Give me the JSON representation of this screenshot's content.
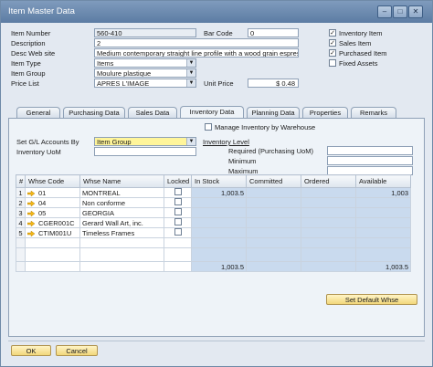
{
  "window": {
    "title": "Item Master Data"
  },
  "header": {
    "item_number_label": "Item Number",
    "item_number_series": "560-410",
    "bar_code_label": "Bar Code",
    "bar_code": "0",
    "description_label": "Description",
    "description": "2",
    "desc_web_label": "Desc Web site",
    "desc_web": "Medium contemporary straight line profile with a wood grain espresso",
    "item_type_label": "Item Type",
    "item_type": "Items",
    "item_group_label": "Item Group",
    "item_group": "Moulure plastique",
    "price_list_label": "Price List",
    "price_list": "APRES L'IMAGE",
    "unit_price_label": "Unit Price",
    "unit_price": "$ 0.48"
  },
  "flags": [
    {
      "label": "Inventory Item",
      "checked": "✓"
    },
    {
      "label": "Sales Item",
      "checked": "✓"
    },
    {
      "label": "Purchased Item",
      "checked": "✓"
    },
    {
      "label": "Fixed Assets",
      "checked": ""
    }
  ],
  "tabs": [
    "General",
    "Purchasing Data",
    "Sales Data",
    "Inventory Data",
    "Planning Data",
    "Properties",
    "Remarks"
  ],
  "inventory": {
    "manage_by_wh_label": "Manage Inventory by Warehouse",
    "gl_label": "Set G/L Accounts By",
    "gl_value": "Item Group",
    "uom_label": "Inventory UoM",
    "inv_level_label": "Inventory Level",
    "required_label": "Required (Purchasing UoM)",
    "minimum_label": "Minimum",
    "maximum_label": "Maximum"
  },
  "grid": {
    "columns": [
      "#",
      "Whse Code",
      "Whse Name",
      "Locked",
      "In Stock",
      "Committed",
      "Ordered",
      "Available"
    ],
    "rows": [
      {
        "num": "1",
        "code": "01",
        "name": "MONTREAL",
        "in_stock": "1,003.5",
        "committed": "",
        "ordered": "",
        "available": "1,003"
      },
      {
        "num": "2",
        "code": "04",
        "name": "Non conforme",
        "in_stock": "",
        "committed": "",
        "ordered": "",
        "available": ""
      },
      {
        "num": "3",
        "code": "05",
        "name": "GEORGIA",
        "in_stock": "",
        "committed": "",
        "ordered": "",
        "available": ""
      },
      {
        "num": "4",
        "code": "CGER001C",
        "name": "Gerard Wall Art, inc.",
        "in_stock": "",
        "committed": "",
        "ordered": "",
        "available": ""
      },
      {
        "num": "5",
        "code": "CTIM001U",
        "name": "Timeless Frames",
        "in_stock": "",
        "committed": "",
        "ordered": "",
        "available": ""
      },
      {
        "num": "",
        "code": "",
        "name": "",
        "in_stock": "",
        "committed": "",
        "ordered": "",
        "available": ""
      }
    ],
    "totals": {
      "in_stock": "1,003.5",
      "available": "1,003.5"
    }
  },
  "buttons": {
    "set_default_whse": "Set Default Whse",
    "ok": "OK",
    "cancel": "Cancel"
  },
  "colors": {
    "titlebar": "#5c7ca3",
    "button": "#f2d77a",
    "gl_highlight": "#fff59a",
    "qty_column": "#c9daee"
  }
}
